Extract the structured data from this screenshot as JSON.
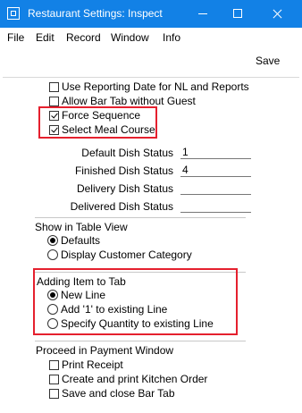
{
  "window": {
    "title": "Restaurant Settings: Inspect",
    "min_icon": "minimize-icon",
    "max_icon": "maximize-icon",
    "close_icon": "close-icon"
  },
  "menu": {
    "items": [
      "File",
      "Edit",
      "Record",
      "Window",
      "Info"
    ]
  },
  "toolbar": {
    "save_label": "Save"
  },
  "options": {
    "items": [
      {
        "label": "Use Reporting Date for NL and Reports",
        "checked": false
      },
      {
        "label": "Allow Bar Tab without Guest",
        "checked": false
      },
      {
        "label": "Force Sequence",
        "checked": true
      },
      {
        "label": "Select Meal Course",
        "checked": true
      }
    ]
  },
  "dish_status": {
    "default": {
      "label": "Default Dish Status",
      "value": "1"
    },
    "finished": {
      "label": "Finished Dish Status",
      "value": "4"
    },
    "delivery": {
      "label": "Delivery Dish Status",
      "value": ""
    },
    "delivered": {
      "label": "Delivered Dish Status",
      "value": ""
    }
  },
  "table_view": {
    "title": "Show in Table View",
    "options": [
      {
        "label": "Defaults",
        "selected": true
      },
      {
        "label": "Display Customer Category",
        "selected": false
      }
    ]
  },
  "adding_item": {
    "title": "Adding Item to Tab",
    "options": [
      {
        "label": "New Line",
        "selected": true
      },
      {
        "label": "Add '1' to existing Line",
        "selected": false
      },
      {
        "label": "Specify Quantity to existing Line",
        "selected": false
      }
    ]
  },
  "payment_window": {
    "title": "Proceed in Payment Window",
    "options": [
      {
        "label": "Print Receipt",
        "checked": false
      },
      {
        "label": "Create and print Kitchen Order",
        "checked": false
      },
      {
        "label": "Save and close Bar Tab",
        "checked": false
      }
    ]
  },
  "colors": {
    "titlebar": "#1281e6",
    "highlight": "#e5202e"
  }
}
